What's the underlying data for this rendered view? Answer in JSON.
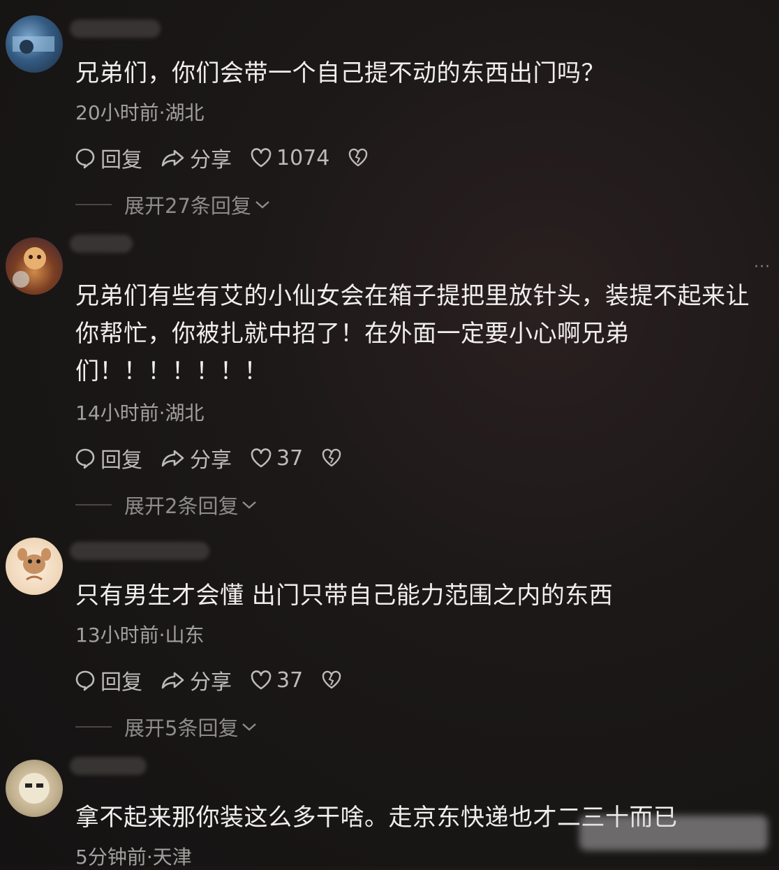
{
  "comments": [
    {
      "text": "兄弟们，你们会带一个自己提不动的东西出门吗？",
      "meta": "20小时前·湖北",
      "reply_label": "回复",
      "share_label": "分享",
      "likes": "1074",
      "expand": "展开27条回复"
    },
    {
      "text": "兄弟们有些有艾的小仙女会在箱子提把里放针头，装提不起来让你帮忙，你被扎就中招了！在外面一定要小心啊兄弟们！！！！！！！",
      "meta": "14小时前·湖北",
      "reply_label": "回复",
      "share_label": "分享",
      "likes": "37",
      "expand": "展开2条回复"
    },
    {
      "text": "只有男生才会懂 出门只带自己能力范围之内的东西",
      "meta": "13小时前·山东",
      "reply_label": "回复",
      "share_label": "分享",
      "likes": "37",
      "expand": "展开5条回复"
    },
    {
      "text": "拿不起来那你装这么多干啥。走京东快递也才二三十而已",
      "meta": "5分钟前·天津"
    }
  ],
  "icons": {
    "reply": "comment-bubble-icon",
    "share": "share-arrow-icon",
    "like": "heart-icon",
    "dislike": "broken-heart-icon",
    "expand": "chevron-down-icon",
    "more": "more-dots-icon"
  },
  "more_label": "···"
}
